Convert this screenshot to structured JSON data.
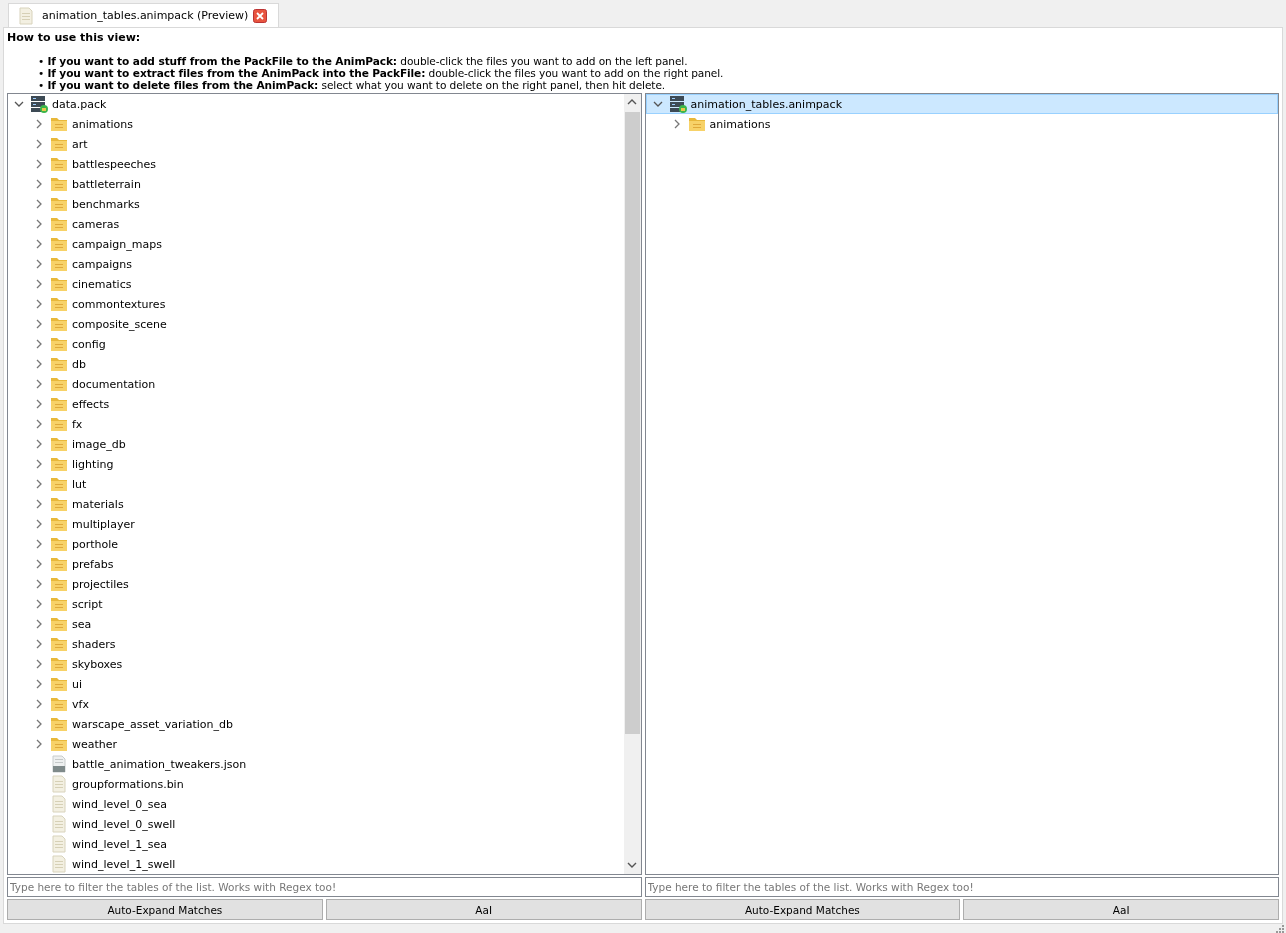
{
  "tabs": [
    {
      "label": "animation_tables.animpack (Preview)",
      "selected": true
    }
  ],
  "help": {
    "title": "How to use this view:",
    "lines": [
      "• **If you want to add stuff from the PackFile to the AnimPack:** double-click the files you want to add on the left panel.",
      "• **If you want to extract files from the AnimPack into the PackFile:** double-click the files you want to add on the right panel.",
      "• **If you want to delete files from the AnimPack:** select what you want to delete on the right panel, then hit delete."
    ]
  },
  "panels": [
    {
      "tree": [
        {
          "label": "data.pack",
          "kind": "pack",
          "expanded": true,
          "selected": false,
          "children": [
            {
              "label": "animations",
              "kind": "folder",
              "expanded": false
            },
            {
              "label": "art",
              "kind": "folder",
              "expanded": false
            },
            {
              "label": "battlespeeches",
              "kind": "folder",
              "expanded": false
            },
            {
              "label": "battleterrain",
              "kind": "folder",
              "expanded": false
            },
            {
              "label": "benchmarks",
              "kind": "folder",
              "expanded": false
            },
            {
              "label": "cameras",
              "kind": "folder",
              "expanded": false
            },
            {
              "label": "campaign_maps",
              "kind": "folder",
              "expanded": false
            },
            {
              "label": "campaigns",
              "kind": "folder",
              "expanded": false
            },
            {
              "label": "cinematics",
              "kind": "folder",
              "expanded": false
            },
            {
              "label": "commontextures",
              "kind": "folder",
              "expanded": false
            },
            {
              "label": "composite_scene",
              "kind": "folder",
              "expanded": false
            },
            {
              "label": "config",
              "kind": "folder",
              "expanded": false
            },
            {
              "label": "db",
              "kind": "folder",
              "expanded": false
            },
            {
              "label": "documentation",
              "kind": "folder",
              "expanded": false
            },
            {
              "label": "effects",
              "kind": "folder",
              "expanded": false
            },
            {
              "label": "fx",
              "kind": "folder",
              "expanded": false
            },
            {
              "label": "image_db",
              "kind": "folder",
              "expanded": false
            },
            {
              "label": "lighting",
              "kind": "folder",
              "expanded": false
            },
            {
              "label": "lut",
              "kind": "folder",
              "expanded": false
            },
            {
              "label": "materials",
              "kind": "folder",
              "expanded": false
            },
            {
              "label": "multiplayer",
              "kind": "folder",
              "expanded": false
            },
            {
              "label": "porthole",
              "kind": "folder",
              "expanded": false
            },
            {
              "label": "prefabs",
              "kind": "folder",
              "expanded": false
            },
            {
              "label": "projectiles",
              "kind": "folder",
              "expanded": false
            },
            {
              "label": "script",
              "kind": "folder",
              "expanded": false
            },
            {
              "label": "sea",
              "kind": "folder",
              "expanded": false
            },
            {
              "label": "shaders",
              "kind": "folder",
              "expanded": false
            },
            {
              "label": "skyboxes",
              "kind": "folder",
              "expanded": false
            },
            {
              "label": "ui",
              "kind": "folder",
              "expanded": false
            },
            {
              "label": "vfx",
              "kind": "folder",
              "expanded": false
            },
            {
              "label": "warscape_asset_variation_db",
              "kind": "folder",
              "expanded": false
            },
            {
              "label": "weather",
              "kind": "folder",
              "expanded": false
            },
            {
              "label": "battle_animation_tweakers.json",
              "kind": "text"
            },
            {
              "label": "groupformations.bin",
              "kind": "file"
            },
            {
              "label": "wind_level_0_sea",
              "kind": "file"
            },
            {
              "label": "wind_level_0_swell",
              "kind": "file"
            },
            {
              "label": "wind_level_1_sea",
              "kind": "file"
            },
            {
              "label": "wind_level_1_swell",
              "kind": "file"
            }
          ]
        }
      ],
      "filter": {
        "placeholder": "Type here to filter the tables of the list. Works with Regex too!"
      },
      "buttons": [
        "Auto-Expand Matches",
        "AaI"
      ]
    },
    {
      "tree": [
        {
          "label": "animation_tables.animpack",
          "kind": "pack",
          "expanded": true,
          "selected": true,
          "children": [
            {
              "label": "animations",
              "kind": "folder",
              "expanded": false
            }
          ]
        }
      ],
      "filter": {
        "placeholder": "Type here to filter the tables of the list. Works with Regex too!"
      },
      "buttons": [
        "Auto-Expand Matches",
        "AaI"
      ]
    }
  ]
}
